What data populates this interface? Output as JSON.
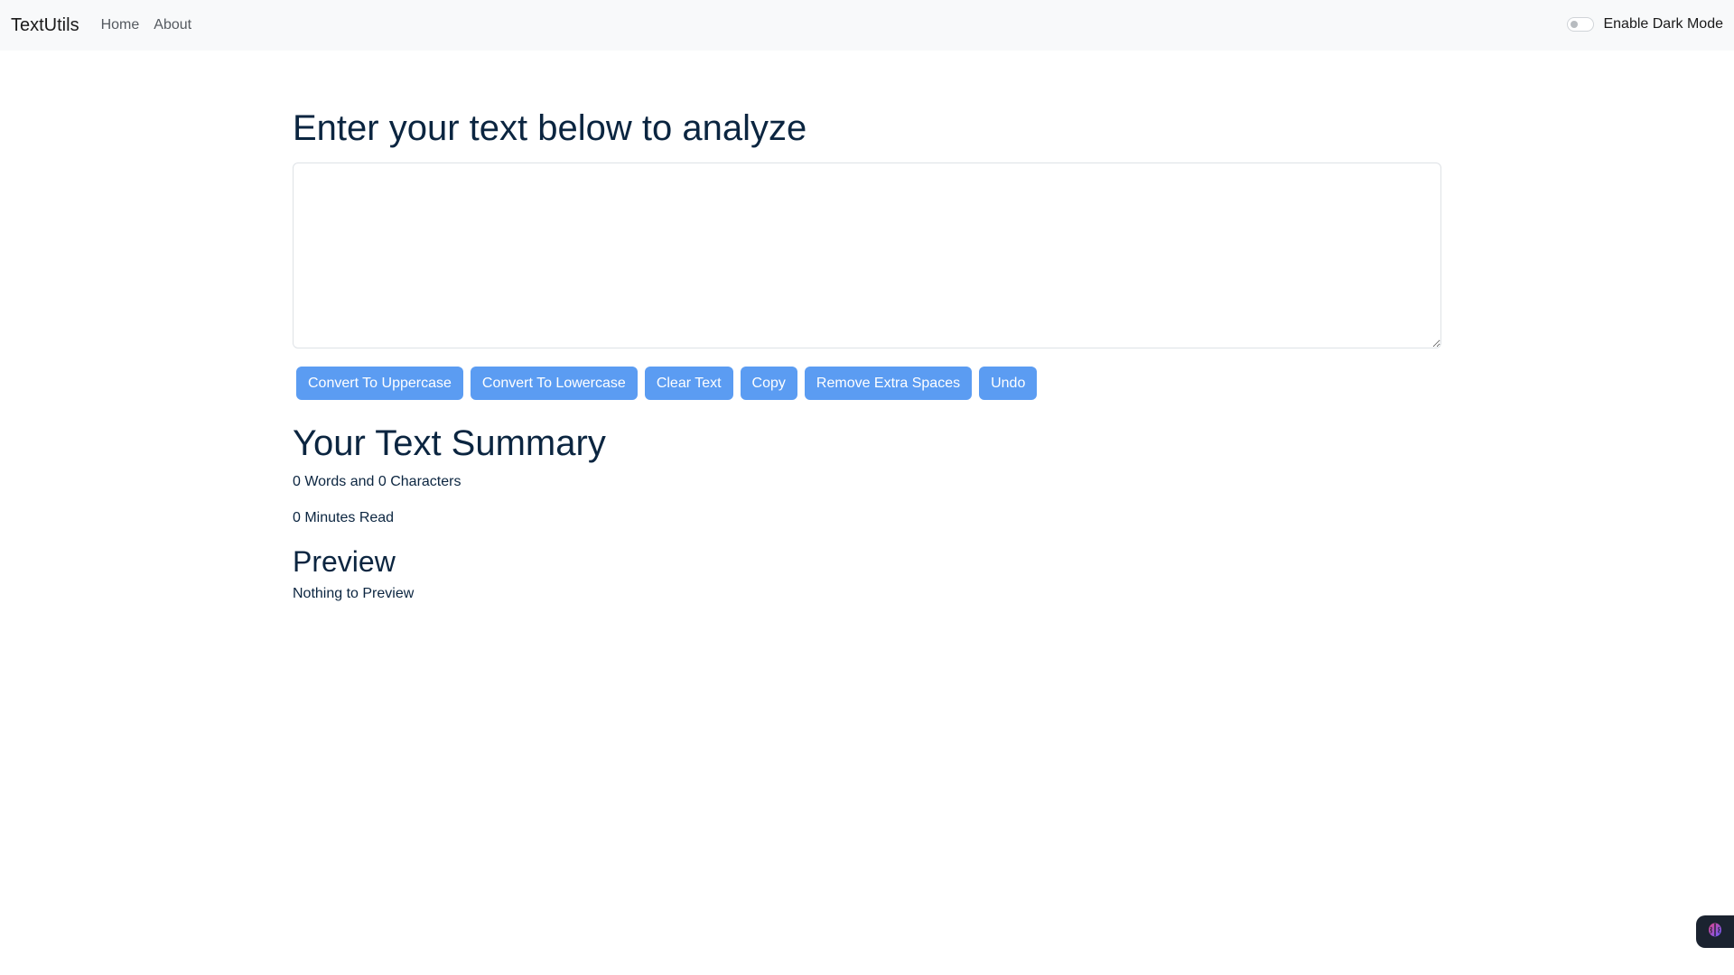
{
  "navbar": {
    "brand": "TextUtils",
    "links": [
      {
        "label": "Home"
      },
      {
        "label": "About"
      }
    ],
    "dark_mode_label": "Enable Dark Mode",
    "dark_mode_enabled": false
  },
  "main": {
    "heading": "Enter your text below to analyze",
    "textarea_value": "",
    "buttons": [
      {
        "label": "Convert To Uppercase"
      },
      {
        "label": "Convert To Lowercase"
      },
      {
        "label": "Clear Text"
      },
      {
        "label": "Copy"
      },
      {
        "label": "Remove Extra Spaces"
      },
      {
        "label": "Undo"
      }
    ]
  },
  "summary": {
    "title": "Your Text Summary",
    "words_chars": "0 Words and 0 Characters",
    "minutes_read": "0 Minutes Read"
  },
  "preview": {
    "title": "Preview",
    "text": "Nothing to Preview"
  },
  "widget": {
    "icon": "brain-icon"
  },
  "colors": {
    "accent_button": "#5b9cf2",
    "heading": "#0b2540",
    "navbar_bg": "#f8f9fa"
  }
}
